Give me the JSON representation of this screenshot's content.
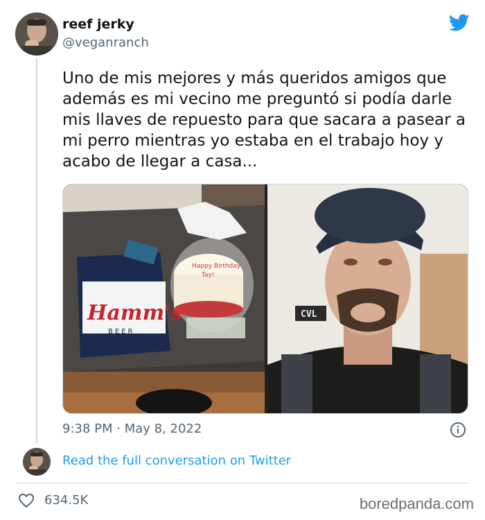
{
  "tweet": {
    "author_name": "reef jerky",
    "author_handle": "@veganranch",
    "text": "Uno de mis mejores y más queridos amigos que además es mi vecino me preguntó si podía darle mis llaves de repuesto para que sacara a pasear a mi perro mientras yo estaba en el trabajo hoy y acabo de llegar a casa...",
    "timestamp": "9:38 PM · May 8, 2022",
    "like_count": "634.5K"
  },
  "media": {
    "left_photo": {
      "cake_text_line1": "Happy Birthday",
      "cake_text_line2": "Tay!",
      "shirt_brand": "Hamm's",
      "shirt_sub": "BEER"
    },
    "right_photo": {
      "sign_text": "CVL"
    }
  },
  "footer": {
    "conversation_link": "Read the full conversation on Twitter",
    "watermark": "boredpanda.com"
  },
  "colors": {
    "link_blue": "#1d9bf0",
    "twitter_blue": "#1d9bf0",
    "secondary_text": "#536471",
    "divider": "#cfd9de"
  },
  "icons": {
    "brand": "twitter-bird-icon",
    "info": "info-icon",
    "like": "heart-icon"
  }
}
